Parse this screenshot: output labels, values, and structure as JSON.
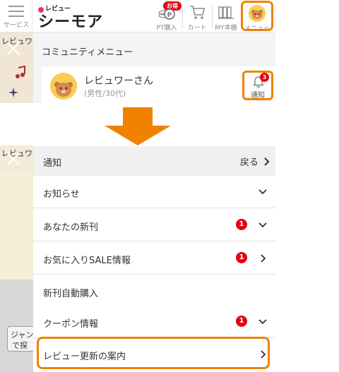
{
  "header": {
    "service_label": "サービス",
    "logo_small": "レビュー",
    "logo_big": "シーモア",
    "badge_otoku": "お得",
    "pt_label": "PT購入",
    "cart_label": "カート",
    "shelf_label": "MY本棚",
    "menu_label": "メニュー"
  },
  "background": {
    "review_label_1": "レビュワ",
    "review_label_2": "レビュワ",
    "genre_label": "ジャン",
    "genre_label_2": "で探"
  },
  "community": {
    "title": "コミュニティメニュー",
    "user_name": "レビュワーさん",
    "user_info": "(男性/30代)",
    "notify_label": "通知",
    "notify_count": "3"
  },
  "notification_panel": {
    "title": "通知",
    "back_label": "戻る",
    "items": [
      {
        "label": "お知らせ",
        "badge": ""
      },
      {
        "label": "あなたの新刊",
        "badge": "1"
      },
      {
        "label": "お気に入りSALE情報",
        "badge": "1"
      },
      {
        "label": "新刊自動購入",
        "badge": ""
      },
      {
        "label": "クーポン情報",
        "badge": "1"
      },
      {
        "label": "レビュー更新の案内",
        "badge": ""
      }
    ]
  },
  "colors": {
    "accent": "#f08200",
    "badge": "#e60012",
    "logo_dot": "#e8336d"
  }
}
